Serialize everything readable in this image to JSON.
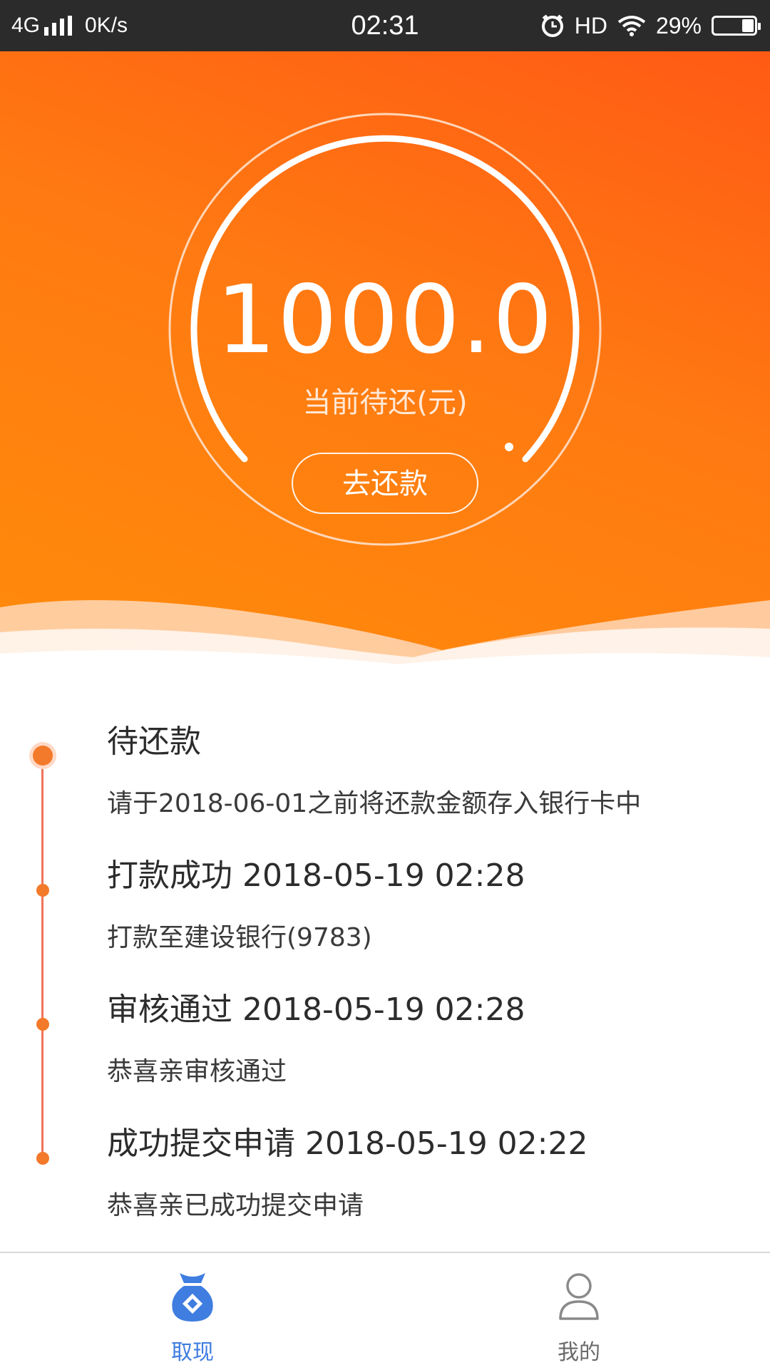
{
  "status_bar": {
    "network": "4G",
    "speed": "0K/s",
    "time": "02:31",
    "hd": "HD",
    "battery": "29%",
    "battery_level": 0.29
  },
  "hero": {
    "amount": "1000.0",
    "amount_label": "当前待还(元)",
    "repay_button": "去还款"
  },
  "timeline": [
    {
      "title": "待还款",
      "sub": "请于2018-06-01之前将还款金额存入银行卡中"
    },
    {
      "title": "打款成功 2018-05-19 02:28",
      "sub": "打款至建设银行(9783)"
    },
    {
      "title": "审核通过 2018-05-19 02:28",
      "sub": "恭喜亲审核通过"
    },
    {
      "title": "成功提交申请 2018-05-19 02:22",
      "sub": "恭喜亲已成功提交申请"
    }
  ],
  "tabs": [
    {
      "label": "取现",
      "icon": "money-bag-icon",
      "active": true
    },
    {
      "label": "我的",
      "icon": "user-icon",
      "active": false
    }
  ],
  "colors": {
    "accent_orange": "#ff7a12",
    "active_tab": "#3f7de0",
    "inactive_tab": "#8a8a8a",
    "timeline_line": "#f0735a"
  }
}
